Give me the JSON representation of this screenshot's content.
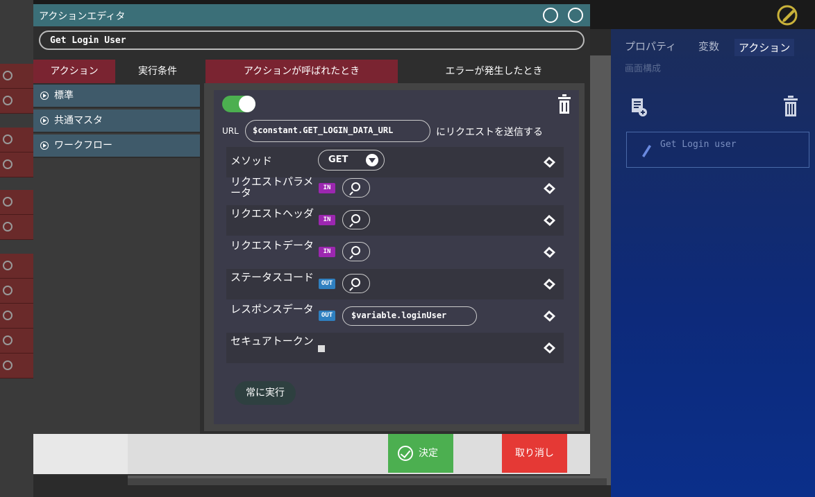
{
  "dialog": {
    "title": "アクションエディタ",
    "name_value": "Get Login User"
  },
  "tabs": {
    "action": "アクション",
    "condition": "実行条件",
    "called": "アクションが呼ばれたとき",
    "error": "エラーが発生したとき"
  },
  "categories": [
    {
      "label": "標準"
    },
    {
      "label": "共通マスタ"
    },
    {
      "label": "ワークフロー"
    }
  ],
  "card": {
    "enabled": true,
    "url_label": "URL",
    "url_value": "$constant.GET_LOGIN_DATA_URL",
    "url_suffix": "にリクエストを送信する",
    "params": {
      "method": {
        "label": "メソッド",
        "value": "GET"
      },
      "req_param": {
        "label": "リクエストパラメータ",
        "badge": "IN"
      },
      "req_header": {
        "label": "リクエストヘッダ",
        "badge": "IN"
      },
      "req_data": {
        "label": "リクエストデータ",
        "badge": "IN"
      },
      "status_code": {
        "label": "ステータスコード",
        "badge": "OUT"
      },
      "response_data": {
        "label": "レスポンスデータ",
        "badge": "OUT",
        "value": "$variable.loginUser"
      },
      "secure_token": {
        "label": "セキュアトークン",
        "checked": false
      }
    },
    "always_run": "常に実行"
  },
  "footer": {
    "ok_label": "決定",
    "cancel_label": "取り消し"
  },
  "right_panel": {
    "tabs": [
      "プロパティ",
      "変数",
      "アクション"
    ],
    "active_tab": "アクション",
    "sub_label": "画面構成",
    "action_item": "Get Login user"
  },
  "colors": {
    "header": "#3b6f78",
    "active_tab": "#7a2431",
    "ok": "#4caf50",
    "cancel": "#e53935",
    "badge_in": "#9c27b0",
    "badge_out": "#2f80c0"
  }
}
